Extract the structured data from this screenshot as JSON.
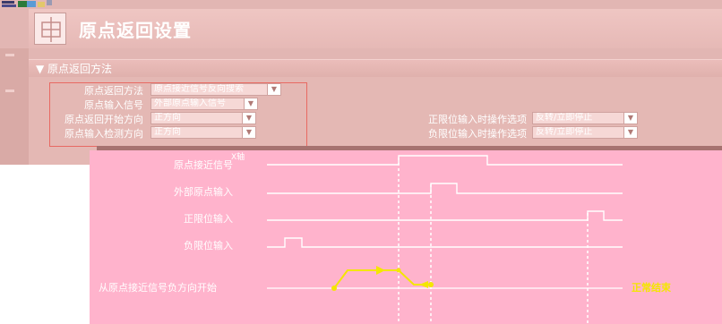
{
  "header": {
    "title": "原点返回设置"
  },
  "section": {
    "title": "▼ 原点返回方法"
  },
  "settings": {
    "method": {
      "label": "原点返回方法",
      "value": "原点接近信号反向搜索"
    },
    "signal": {
      "label": "原点输入信号",
      "value": "外部原点输入信号"
    },
    "start_dir": {
      "label": "原点返回开始方向",
      "value": "正方向"
    },
    "detect_dir": {
      "label": "原点输入检测方向",
      "value": "正方向"
    },
    "pos_limit": {
      "label": "正限位输入时操作选项",
      "value": "反转/立即停止"
    },
    "neg_limit": {
      "label": "负限位输入时操作选项",
      "value": "反转/立即停止"
    }
  },
  "diagram": {
    "signals": [
      "原点接近信号",
      "外部原点输入",
      "正限位输入",
      "负限位输入"
    ],
    "path_label": "从原点接近信号负方向开始",
    "end_label": "正常结束",
    "overlay_text": "X轴"
  }
}
